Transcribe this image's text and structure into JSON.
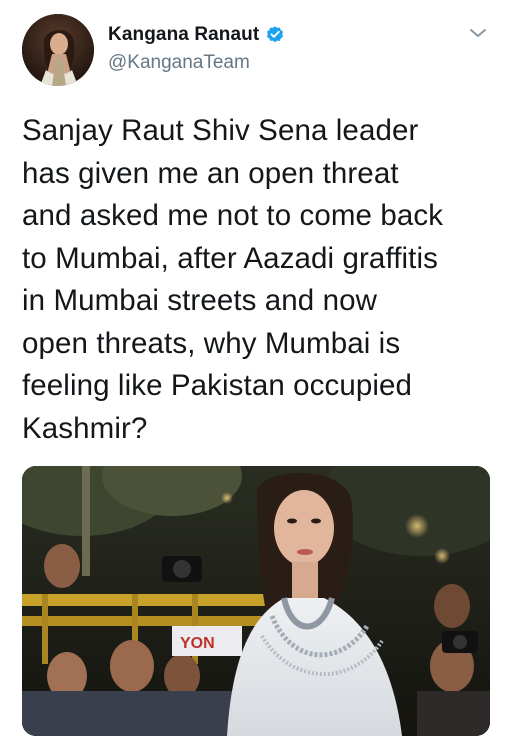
{
  "user": {
    "display_name": "Kangana Ranaut",
    "handle": "@KanganaTeam",
    "verified": true
  },
  "tweet": {
    "lines": [
      "Sanjay Raut Shiv Sena leader",
      "has given me an open threat",
      "and asked me not to come back",
      "to Mumbai, after Aazadi graffitis",
      "in Mumbai streets and now",
      "open threats, why Mumbai is",
      "feeling like Pakistan occupied",
      "Kashmir?"
    ]
  },
  "media": {
    "type": "photo",
    "banner_text": "YON"
  },
  "icons": {
    "verified": "verified-badge-icon",
    "caret": "chevron-down-icon"
  },
  "colors": {
    "verified_blue": "#1da1f2",
    "handle_gray": "#657786",
    "text": "#14171a"
  }
}
